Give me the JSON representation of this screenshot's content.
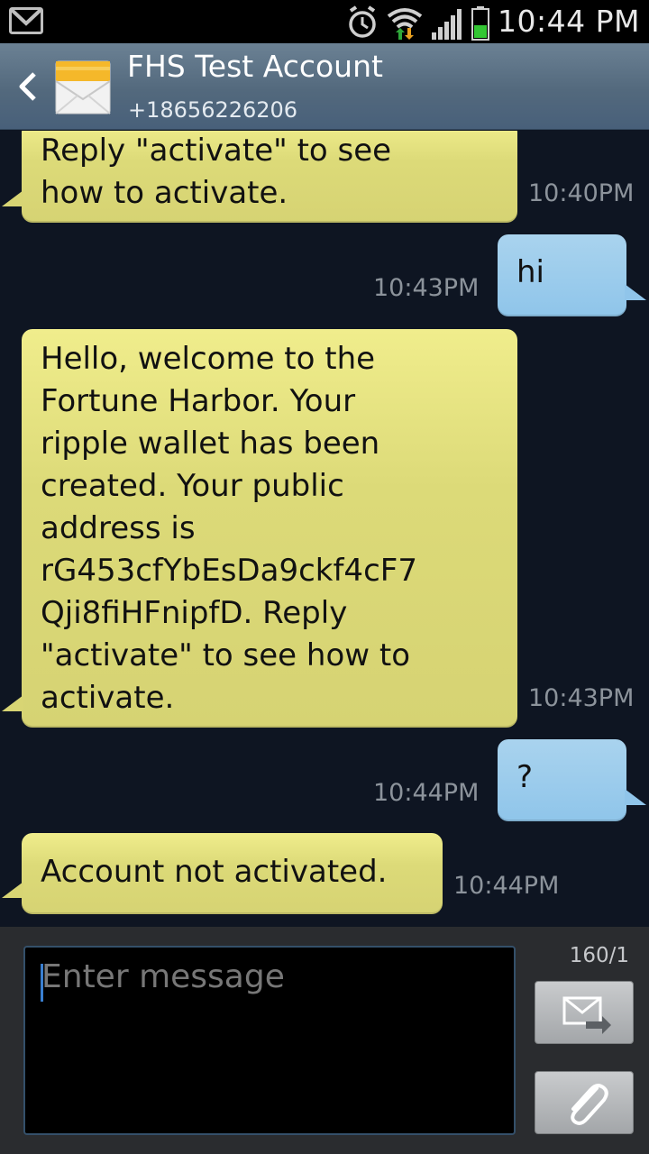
{
  "status_bar": {
    "time": "10:44 PM",
    "icons": [
      "gmail-icon",
      "alarm-icon",
      "wifi-icon",
      "signal-icon",
      "battery-icon"
    ]
  },
  "header": {
    "contact_name": "FHS Test Account",
    "contact_number": "+18656226206"
  },
  "messages": [
    {
      "direction": "incoming",
      "text": "Reply \"activate\" to see\nhow to activate.",
      "time": "10:40PM"
    },
    {
      "direction": "outgoing",
      "text": "hi",
      "time": "10:43PM"
    },
    {
      "direction": "incoming",
      "text": "Hello, welcome to the\nFortune Harbor. Your\nripple wallet has been\ncreated. Your public\naddress is\nrG453cfYbEsDa9ckf4cF7\nQji8fiHFnipfD. Reply\n\"activate\" to see how to\nactivate.",
      "time": "10:43PM"
    },
    {
      "direction": "outgoing",
      "text": "?",
      "time": "10:44PM"
    },
    {
      "direction": "incoming",
      "text": "Account not activated.",
      "time": "10:44PM"
    }
  ],
  "compose": {
    "placeholder": "Enter message",
    "char_counter": "160/1"
  },
  "colors": {
    "incoming_bubble": "#dcda78",
    "outgoing_bubble": "#8fc5ea",
    "conversation_bg": "#0e1522",
    "header_bg": "#53697d"
  }
}
